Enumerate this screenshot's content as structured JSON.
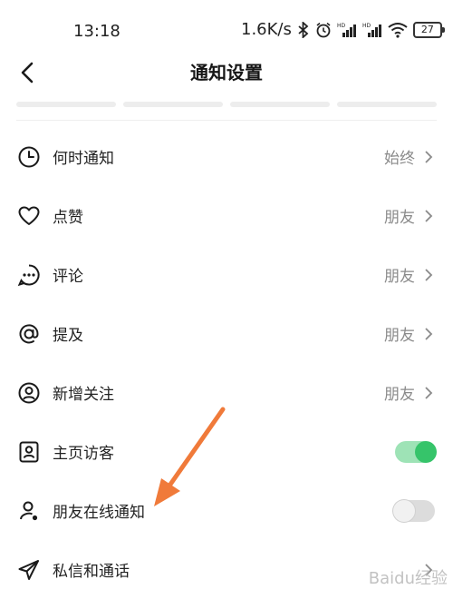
{
  "status_bar": {
    "time": "13:18",
    "network_speed": "1.6K/s",
    "battery": "27"
  },
  "header": {
    "title": "通知设置"
  },
  "items": [
    {
      "label": "何时通知",
      "value": "始终",
      "icon": "clock-icon"
    },
    {
      "label": "点赞",
      "value": "朋友",
      "icon": "heart-icon"
    },
    {
      "label": "评论",
      "value": "朋友",
      "icon": "comment-icon"
    },
    {
      "label": "提及",
      "value": "朋友",
      "icon": "at-icon"
    },
    {
      "label": "新增关注",
      "value": "朋友",
      "icon": "user-circle-icon"
    },
    {
      "label": "主页访客",
      "toggle": "on",
      "icon": "profile-card-icon"
    },
    {
      "label": "朋友在线通知",
      "toggle": "off",
      "icon": "user-online-icon"
    },
    {
      "label": "私信和通话",
      "value": "",
      "icon": "send-icon"
    }
  ],
  "watermark": "Baidu经验",
  "colors": {
    "toggle_on": "#36c46a",
    "annotation_arrow": "#f07a3a"
  }
}
